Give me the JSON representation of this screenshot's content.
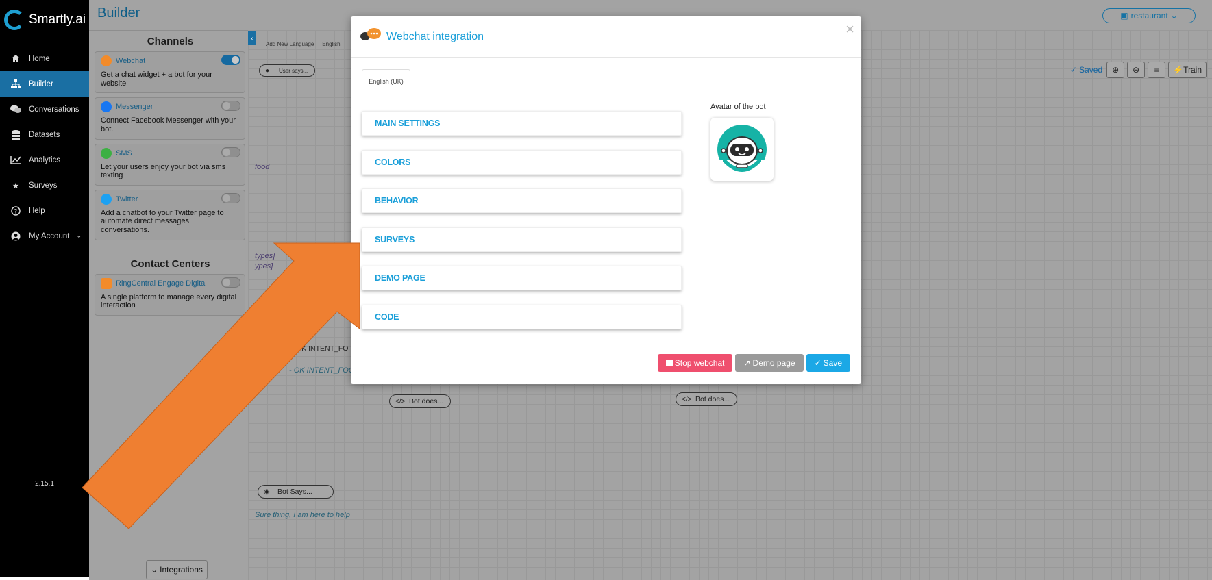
{
  "app": {
    "logo_text": "Smartly.ai",
    "version": "2.15.1"
  },
  "sidebar": {
    "items": [
      {
        "label": "Home",
        "icon": "home-icon"
      },
      {
        "label": "Builder",
        "icon": "sitemap-icon",
        "active": true
      },
      {
        "label": "Conversations",
        "icon": "comments-icon"
      },
      {
        "label": "Datasets",
        "icon": "database-icon"
      },
      {
        "label": "Analytics",
        "icon": "line-chart-icon"
      },
      {
        "label": "Surveys",
        "icon": "star-icon"
      },
      {
        "label": "Help",
        "icon": "question-icon"
      },
      {
        "label": "My Account",
        "icon": "user-icon"
      }
    ]
  },
  "header": {
    "title": "Builder",
    "bot_selector": "restaurant"
  },
  "channels": {
    "heading": "Channels",
    "items": [
      {
        "name": "Webchat",
        "desc": "Get a chat widget + a bot for your website",
        "enabled": true,
        "color": "#f28b2a"
      },
      {
        "name": "Messenger",
        "desc": "Connect Facebook Messenger with your bot.",
        "enabled": false,
        "color": "#1877f2"
      },
      {
        "name": "SMS",
        "desc": "Let your users enjoy your bot via sms texting",
        "enabled": false,
        "color": "#3cb043"
      },
      {
        "name": "Twitter",
        "desc": "Add a chatbot to your Twitter page to automate direct messages conversations.",
        "enabled": false,
        "color": "#1da1f2"
      }
    ],
    "contact_heading": "Contact Centers",
    "contact_items": [
      {
        "name": "RingCentral Engage Digital",
        "desc": "A single platform to manage every digital interaction",
        "enabled": false,
        "color": "#f28b2a"
      }
    ],
    "integrations_label": "Integrations"
  },
  "canvas": {
    "tabs": [
      "Add New Language",
      "English"
    ],
    "saved": "Saved",
    "train": "Train",
    "nodes": {
      "user_says": "User says...",
      "bot_does_1": "Bot does...",
      "bot_does_2": "Bot does...",
      "bot_says": "Bot Says...",
      "ok_intent": "OK INTENT_FO"
    },
    "texts": {
      "food": "food",
      "types1": "types]",
      "types2": "ypes]",
      "ok_intent_text": "- OK INTENT_FOO",
      "sure": "Sure thing, I am here to help"
    }
  },
  "modal": {
    "title": "Webchat integration",
    "close": "×",
    "tab": "English (UK)",
    "sections": [
      "MAIN SETTINGS",
      "COLORS",
      "BEHAVIOR",
      "SURVEYS",
      "DEMO PAGE",
      "CODE"
    ],
    "avatar_label": "Avatar of the bot",
    "buttons": {
      "stop": "Stop webchat",
      "demo": "Demo page",
      "save": "Save"
    }
  },
  "colors": {
    "accent": "#1a9fd9",
    "stop": "#ef4f6e",
    "arrow": "#ef7f31"
  }
}
